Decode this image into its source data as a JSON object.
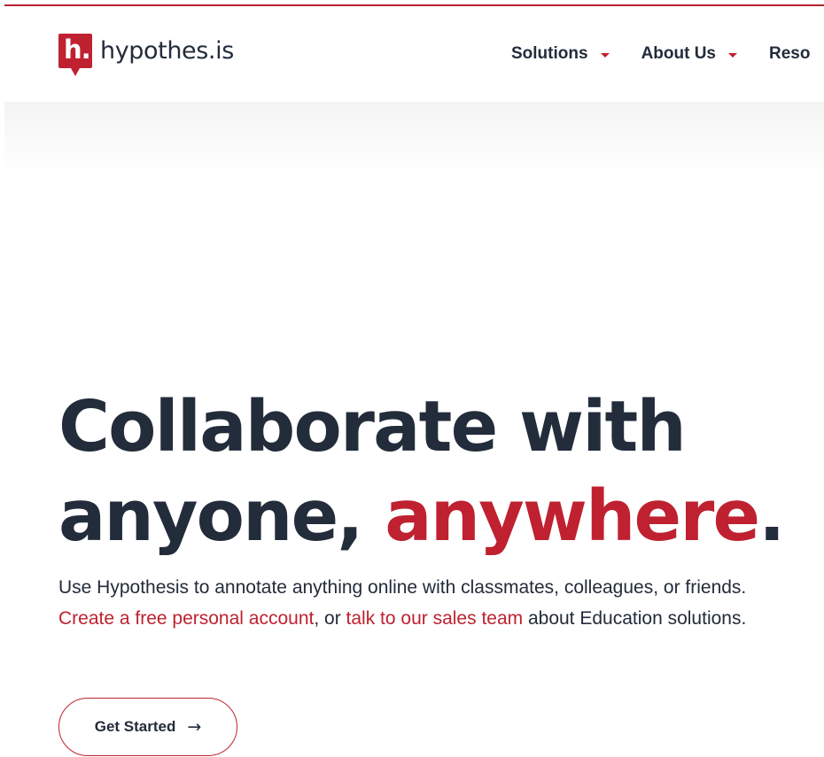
{
  "header": {
    "logo": {
      "mark": "h.",
      "word": "hypothes.is"
    },
    "nav": [
      {
        "label": "Solutions",
        "has_dropdown": true,
        "icon": "caret-down-icon"
      },
      {
        "label": "About Us",
        "has_dropdown": true,
        "icon": "caret-down-icon"
      },
      {
        "label": "Reso",
        "has_dropdown": false
      }
    ]
  },
  "hero": {
    "headline": {
      "line1": "Collaborate with",
      "line2_start": "anyone, ",
      "line2_accent": "anywhere",
      "line2_end": "."
    },
    "copy": {
      "text_1": "Use Hypothesis to annotate anything online with classmates, colleagues, or friends. ",
      "link_1": "Create a free personal account",
      "text_2": ", or ",
      "link_2": "talk to our sales team",
      "text_3": " about Education solutions."
    },
    "cta": {
      "label": "Get Started",
      "icon": "arrow-right-icon",
      "glyph": "→"
    }
  },
  "colors": {
    "brand": "#bf2130",
    "text": "#232c3b",
    "background": "#ffffff"
  }
}
